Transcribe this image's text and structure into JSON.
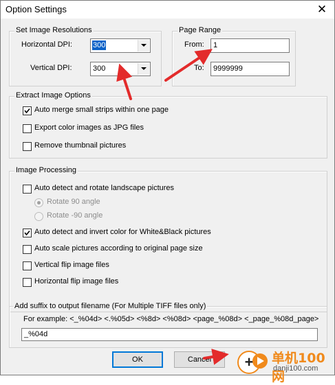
{
  "window": {
    "title": "Option Settings",
    "close_glyph": "✕"
  },
  "resolution": {
    "legend": "Set Image Resolutions",
    "horizontal_label": "Horizontal DPI:",
    "horizontal_value": "300",
    "vertical_label": "Vertical DPI:",
    "vertical_value": "300"
  },
  "page_range": {
    "legend": "Page Range",
    "from_label": "From:",
    "from_value": "1",
    "to_label": "To:",
    "to_value": "9999999"
  },
  "extract": {
    "legend": "Extract Image Options",
    "options": [
      {
        "label": "Auto merge small strips within one page",
        "checked": true
      },
      {
        "label": "Export color images as JPG files",
        "checked": false
      },
      {
        "label": "Remove thumbnail pictures",
        "checked": false
      }
    ]
  },
  "processing": {
    "legend": "Image Processing",
    "rotate_label": "Auto detect and rotate landscape pictures",
    "rotate_90": "Rotate 90 angle",
    "rotate_neg90": "Rotate -90 angle",
    "invert_label": "Auto detect and invert color for White&Black pictures",
    "scale_label": "Auto scale pictures according to original page size",
    "vflip_label": "Vertical flip image files",
    "hflip_label": "Horizontal flip image files"
  },
  "suffix": {
    "legend": "Add suffix to output filename (For Multiple TIFF files only)",
    "example": "For example: <_%04d> <.%05d> <%8d> <%08d> <page_%08d> <_page_%08d_page>",
    "value": "_%04d"
  },
  "buttons": {
    "ok": "OK",
    "cancel": "Cancel"
  },
  "watermark": {
    "brand": "单机100网",
    "domain": "danji100.com"
  },
  "colors": {
    "accent": "#0078d7",
    "arrow": "#e32b2b",
    "watermark": "#f08a1c"
  }
}
